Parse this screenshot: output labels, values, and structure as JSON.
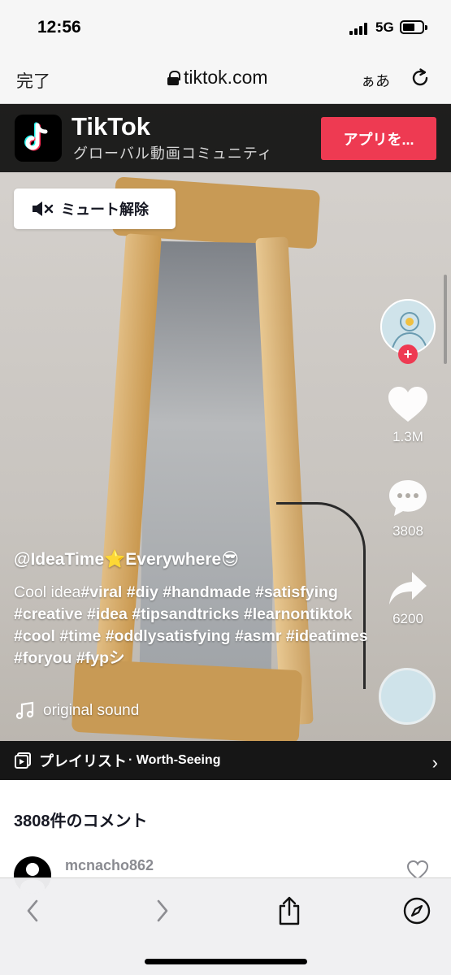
{
  "status_bar": {
    "time": "12:56",
    "network": "5G"
  },
  "url_bar": {
    "done_label": "完了",
    "domain": "tiktok.com",
    "text_size_label": "ぁあ"
  },
  "header": {
    "brand": "TikTok",
    "tagline": "グローバル動画コミュニティ",
    "open_app_label": "アプリを...",
    "accent_color": "#ee3a52"
  },
  "video": {
    "unmute_label": "ミュート解除",
    "author": "@IdeaTime⭐Everywhere😎",
    "caption_lead": "Cool idea",
    "caption_tags": "#viral #diy #handmade #satisfying #creative #idea #tipsandtricks #learnontiktok #cool #time #oddlysatisfying #asmr #ideatimes #foryou #fypシ",
    "sound": "original sound",
    "likes": "1.3M",
    "comments": "3808",
    "shares": "6200"
  },
  "playlist": {
    "title": "プレイリスト",
    "name": "· Worth-Seeing"
  },
  "comments_section": {
    "title": "3808件のコメント",
    "first_user": "mcnacho862"
  },
  "icons": [
    "lock-icon",
    "reload-icon",
    "tiktok-logo-icon",
    "speaker-muted-icon",
    "heart-icon",
    "comment-icon",
    "share-icon",
    "music-note-icon",
    "playlist-icon",
    "chevron-right-icon",
    "back-icon",
    "forward-icon",
    "share-upload-icon",
    "compass-icon"
  ]
}
